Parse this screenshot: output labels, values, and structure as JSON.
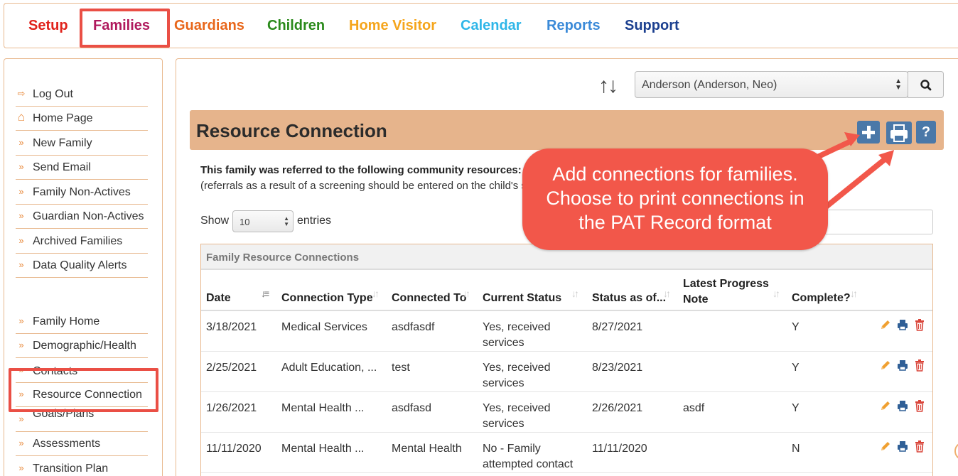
{
  "nav": {
    "items": [
      {
        "label": "Setup",
        "color": "#e0221b"
      },
      {
        "label": "Families",
        "color": "#b0195d"
      },
      {
        "label": "Guardians",
        "color": "#e8661a"
      },
      {
        "label": "Children",
        "color": "#2a8a1b"
      },
      {
        "label": "Home Visitor",
        "color": "#f5a51b"
      },
      {
        "label": "Calendar",
        "color": "#2fb6e8"
      },
      {
        "label": "Reports",
        "color": "#3b8ad8"
      },
      {
        "label": "Support",
        "color": "#1b3f8f"
      }
    ]
  },
  "sidebar": {
    "top_items": [
      {
        "label": "Log Out",
        "icon": "sign-out-icon"
      },
      {
        "label": "Home Page",
        "icon": "home-icon"
      },
      {
        "label": "New Family",
        "icon": "double-chevron-icon"
      },
      {
        "label": "Send Email",
        "icon": "double-chevron-icon"
      },
      {
        "label": "Family Non-Actives",
        "icon": "double-chevron-icon"
      },
      {
        "label": "Guardian Non-Actives",
        "icon": "double-chevron-icon"
      },
      {
        "label": "Archived Families",
        "icon": "double-chevron-icon"
      },
      {
        "label": "Data Quality Alerts",
        "icon": "double-chevron-icon"
      }
    ],
    "family_items": [
      {
        "label": "Family Home"
      },
      {
        "label": "Demographic/Health"
      },
      {
        "label": "Contacts"
      },
      {
        "label": "Resource Connection"
      },
      {
        "label": "Goals/Plans"
      },
      {
        "label": "Assessments"
      },
      {
        "label": "Transition Plan"
      }
    ]
  },
  "family_select": {
    "value": "Anderson (Anderson, Neo)"
  },
  "panel": {
    "title": "Resource Connection",
    "intro_bold": "This family was referred to the following community resources:",
    "intro_note": "(referrals as a result of a screening should be entered on the child's screening page)",
    "show_label": "Show",
    "page_length": "10",
    "entries_label": "entries"
  },
  "table": {
    "caption": "Family Resource Connections",
    "columns": [
      "Date",
      "Connection Type",
      "Connected To",
      "Current Status",
      "Status as of...",
      "Latest Progress Note",
      "Complete?"
    ],
    "rows": [
      {
        "date": "3/18/2021",
        "type": "Medical Services",
        "to": "asdfasdf",
        "status_l1": "Yes, received",
        "status_l2": "services",
        "as_of": "8/27/2021",
        "note": "",
        "complete": "Y"
      },
      {
        "date": "2/25/2021",
        "type": "Adult Education, ...",
        "to": "test",
        "status_l1": "Yes, received",
        "status_l2": "services",
        "as_of": "8/23/2021",
        "note": "",
        "complete": "Y"
      },
      {
        "date": "1/26/2021",
        "type": "Mental Health ...",
        "to": "asdfasd",
        "status_l1": "Yes, received",
        "status_l2": "services",
        "as_of": "2/26/2021",
        "note": "asdf",
        "complete": "Y"
      },
      {
        "date": "11/11/2020",
        "type": "Mental Health ...",
        "to": "Mental Health",
        "status_l1": "No - Family",
        "status_l2": "attempted contact",
        "as_of": "11/11/2020",
        "note": "",
        "complete": "N"
      }
    ]
  },
  "callout": {
    "lines": [
      "Add connections for families.",
      "Choose to print connections in",
      "the PAT Record format"
    ],
    "color": "#f2574a"
  }
}
